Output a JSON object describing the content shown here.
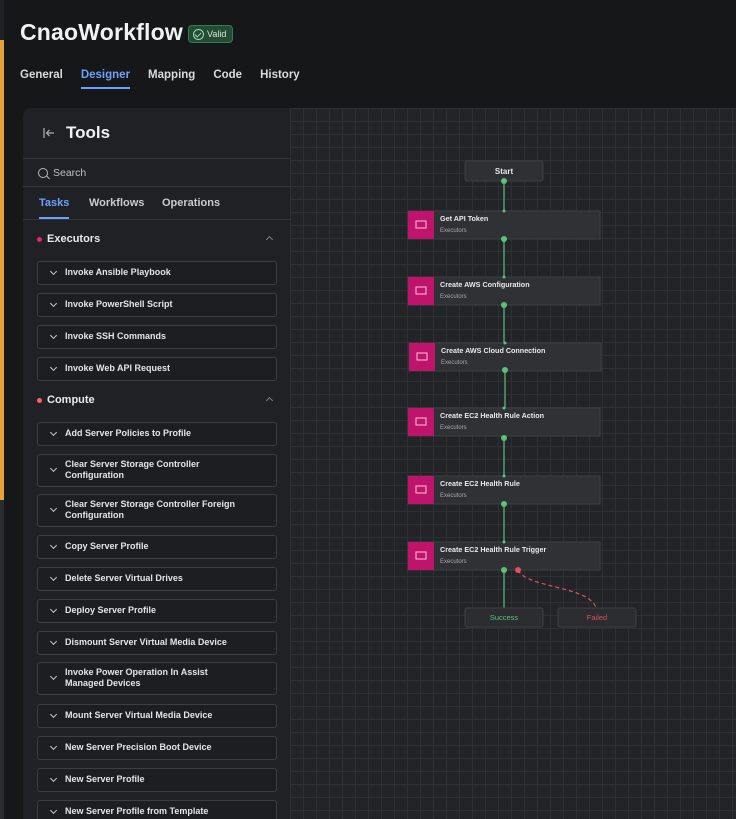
{
  "app": {
    "title": "CnaoWorkflow",
    "status_badge": "Valid",
    "tabs": [
      {
        "label": "General"
      },
      {
        "label": "Designer"
      },
      {
        "label": "Mapping"
      },
      {
        "label": "Code"
      },
      {
        "label": "History"
      }
    ],
    "active_tab": "Designer"
  },
  "tools": {
    "title": "Tools",
    "search_placeholder": "Search",
    "subtabs": [
      {
        "label": "Tasks"
      },
      {
        "label": "Workflows"
      },
      {
        "label": "Operations"
      }
    ],
    "sections": [
      {
        "label": "Executors",
        "items": [
          "Invoke Ansible Playbook",
          "Invoke PowerShell Script",
          "Invoke SSH Commands",
          "Invoke Web API Request"
        ]
      },
      {
        "label": "Compute",
        "items": [
          "Add Server Policies to Profile",
          "Clear Server Storage Controller Configuration",
          "Clear Server Storage Controller Foreign Configuration",
          "Copy Server Profile",
          "Delete Server Virtual Drives",
          "Deploy Server Profile",
          "Dismount Server Virtual Media Device",
          "Invoke Power Operation In Assist Managed Devices",
          "Mount Server Virtual Media Device",
          "New Server Precision Boot Device",
          "New Server Profile",
          "New Server Profile from Template"
        ]
      }
    ]
  },
  "workflow": {
    "start_label": "Start",
    "nodes": [
      {
        "title": "Get API Token",
        "category": "Executors"
      },
      {
        "title": "Create AWS Configuration",
        "category": "Executors"
      },
      {
        "title": "Create AWS Cloud Connection",
        "category": "Executors"
      },
      {
        "title": "Create EC2 Health Rule Action",
        "category": "Executors"
      },
      {
        "title": "Create EC2 Health Rule",
        "category": "Executors"
      },
      {
        "title": "Create EC2 Health Rule Trigger",
        "category": "Executors"
      }
    ],
    "success_label": "Success",
    "failed_label": "Failed"
  },
  "colors": {
    "accent": "#6ea0ff",
    "executor_icon": "#c0136b",
    "success_edge": "#5fc07a",
    "failed_edge": "#e0505c",
    "valid_badge": "#244b34"
  }
}
